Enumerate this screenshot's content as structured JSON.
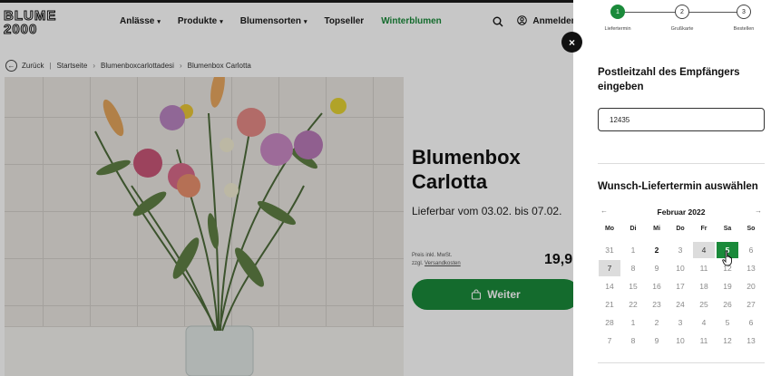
{
  "shop": {
    "logo": [
      "BLUME",
      "2000"
    ],
    "nav": [
      {
        "label": "Anlässe",
        "caret": true
      },
      {
        "label": "Produkte",
        "caret": true
      },
      {
        "label": "Blumensorten",
        "caret": true
      },
      {
        "label": "Topseller",
        "caret": false
      },
      {
        "label": "Winterblumen",
        "caret": false
      }
    ],
    "login_label": "Anmelden",
    "breadcrumb": {
      "back": "Zurück",
      "items": [
        "Startseite",
        "Blumenboxcarlottadesi",
        "Blumenbox Carlotta"
      ]
    },
    "product": {
      "title_line1": "Blumenbox",
      "title_line2": "Carlotta",
      "availability": "Lieferbar vom 03.02. bis 07.02.",
      "price_note_line1": "Preis inkl. MwSt.",
      "price_note_prefix": "zzgl.",
      "price_note_link": "Versandkosten",
      "price": "19,9",
      "cta_label": "Weiter"
    }
  },
  "panel": {
    "close_symbol": "×",
    "steps": [
      {
        "number": "1",
        "label": "Liefertermin",
        "active": true
      },
      {
        "number": "2",
        "label": "Grußkarte",
        "active": false
      },
      {
        "number": "3",
        "label": "Bestellen",
        "active": false
      }
    ],
    "zip_section": {
      "title": "Postleitzahl des Empfängers eingeben",
      "value": "12435"
    },
    "date_section": {
      "title": "Wunsch-Liefertermin auswählen"
    },
    "calendar": {
      "month": "Februar 2022",
      "prev_symbol": "←",
      "next_symbol": "→",
      "weekdays": [
        "Mo",
        "Di",
        "Mi",
        "Do",
        "Fr",
        "Sa",
        "So"
      ],
      "weeks": [
        [
          {
            "d": "31",
            "s": "muted"
          },
          {
            "d": "1",
            "s": "muted"
          },
          {
            "d": "2",
            "s": "bold"
          },
          {
            "d": "3",
            "s": "muted"
          },
          {
            "d": "4",
            "s": "grey"
          },
          {
            "d": "5",
            "s": "sel"
          },
          {
            "d": "6",
            "s": "muted"
          }
        ],
        [
          {
            "d": "7",
            "s": "grey"
          },
          {
            "d": "8",
            "s": "muted"
          },
          {
            "d": "9",
            "s": "muted"
          },
          {
            "d": "10",
            "s": "muted"
          },
          {
            "d": "11",
            "s": "muted"
          },
          {
            "d": "12",
            "s": "muted"
          },
          {
            "d": "13",
            "s": "muted"
          }
        ],
        [
          {
            "d": "14",
            "s": "muted"
          },
          {
            "d": "15",
            "s": "muted"
          },
          {
            "d": "16",
            "s": "muted"
          },
          {
            "d": "17",
            "s": "muted"
          },
          {
            "d": "18",
            "s": "muted"
          },
          {
            "d": "19",
            "s": "muted"
          },
          {
            "d": "20",
            "s": "muted"
          }
        ],
        [
          {
            "d": "21",
            "s": "muted"
          },
          {
            "d": "22",
            "s": "muted"
          },
          {
            "d": "23",
            "s": "muted"
          },
          {
            "d": "24",
            "s": "muted"
          },
          {
            "d": "25",
            "s": "muted"
          },
          {
            "d": "26",
            "s": "muted"
          },
          {
            "d": "27",
            "s": "muted"
          }
        ],
        [
          {
            "d": "28",
            "s": "muted"
          },
          {
            "d": "1",
            "s": "muted"
          },
          {
            "d": "2",
            "s": "muted"
          },
          {
            "d": "3",
            "s": "muted"
          },
          {
            "d": "4",
            "s": "muted"
          },
          {
            "d": "5",
            "s": "muted"
          },
          {
            "d": "6",
            "s": "muted"
          }
        ],
        [
          {
            "d": "7",
            "s": "muted"
          },
          {
            "d": "8",
            "s": "muted"
          },
          {
            "d": "9",
            "s": "muted"
          },
          {
            "d": "10",
            "s": "muted"
          },
          {
            "d": "11",
            "s": "muted"
          },
          {
            "d": "12",
            "s": "muted"
          },
          {
            "d": "13",
            "s": "muted"
          }
        ]
      ]
    }
  },
  "colors": {
    "brand_green": "#1a8a3a",
    "overlay": "rgba(0,0,0,0.22)"
  }
}
